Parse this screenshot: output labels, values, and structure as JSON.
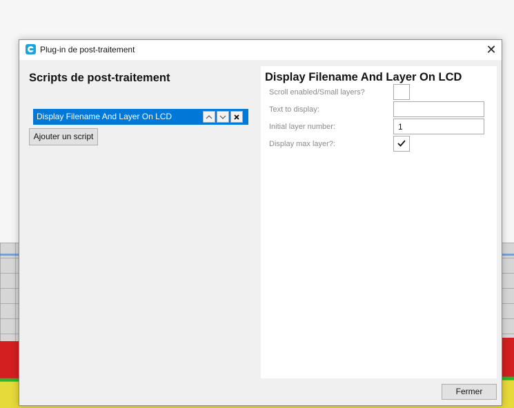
{
  "window": {
    "title": "Plug-in de post-traitement",
    "close_glyph": "✕",
    "icon": "cura-app-icon"
  },
  "left": {
    "section_title": "Scripts de post-traitement",
    "scripts": [
      {
        "label": "Display Filename And Layer On LCD",
        "selected": true
      }
    ],
    "move_up_glyph": "︿",
    "move_down_glyph": "﹀",
    "remove_glyph": "✕",
    "add_button_label": "Ajouter un script"
  },
  "right": {
    "title": "Display Filename And Layer On LCD",
    "settings": {
      "scroll_enabled": {
        "label": "Scroll enabled/Small layers?",
        "checked": false
      },
      "text_to_display": {
        "label": "Text to display:",
        "value": ""
      },
      "initial_layer_number": {
        "label": "Initial layer number:",
        "value": "1"
      },
      "display_max_layer": {
        "label": "Display max layer?:",
        "checked": true
      }
    }
  },
  "footer": {
    "close_button_label": "Fermer"
  },
  "colors": {
    "selection": "#0078d7",
    "accent": "#1ba4de"
  }
}
